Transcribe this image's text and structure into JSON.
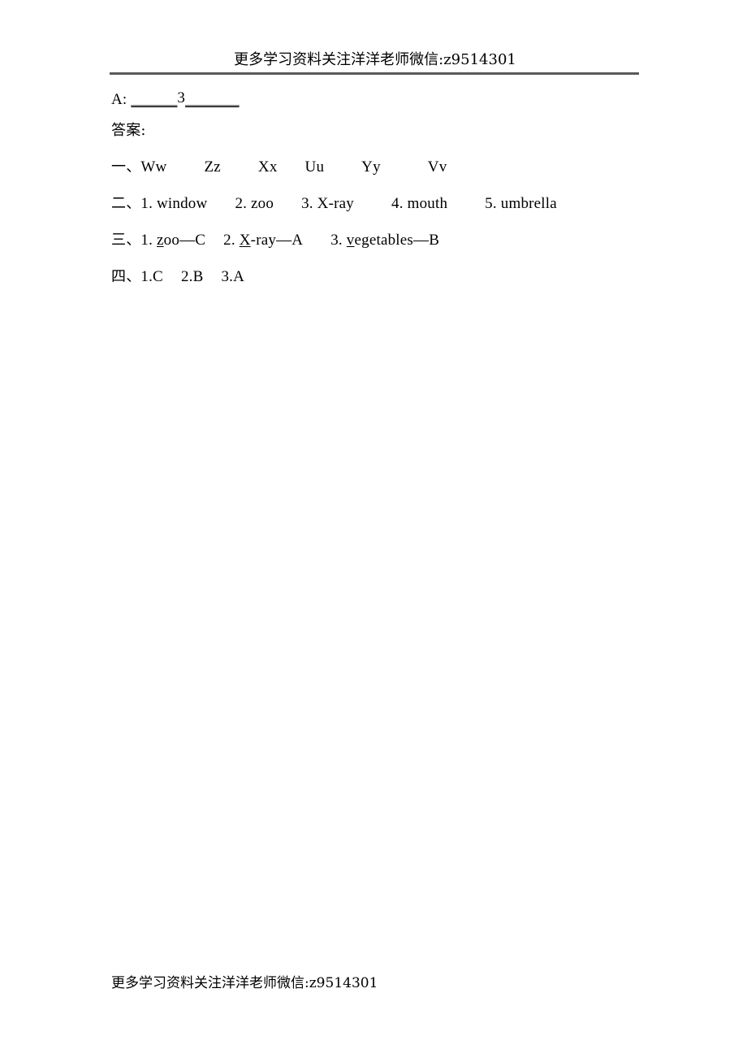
{
  "document": {
    "header_note": "更多学习资料关注洋洋老师微信:z9514301",
    "footer_note": "更多学习资料关注洋洋老师微信:z9514301"
  },
  "dialogue": {
    "speaker": "A:",
    "blank_before": "______",
    "number": "3",
    "blank_after": "_______"
  },
  "answers": {
    "heading": "答案:",
    "sections": [
      {
        "label": "一、",
        "items": [
          "Ww",
          "Zz",
          "Xx",
          "Uu",
          "Yy",
          "Vv"
        ]
      },
      {
        "label": "二、",
        "items": [
          "1. window",
          "2. zoo",
          "3. X-ray",
          "4. mouth",
          "5. umbrella"
        ]
      },
      {
        "label": "三、",
        "items": [
          {
            "num": "1. ",
            "initial": "z",
            "rest": "oo",
            "dash": "—",
            "answer": "C"
          },
          {
            "num": "2. ",
            "initial": "X",
            "rest": "-ray",
            "dash": "—",
            "answer": "A"
          },
          {
            "num": "3. ",
            "initial": "v",
            "rest": "egetables",
            "dash": "—",
            "answer": "B"
          }
        ]
      },
      {
        "label": "四、",
        "items": [
          "1.C",
          "2.B",
          "3.A"
        ]
      }
    ]
  }
}
